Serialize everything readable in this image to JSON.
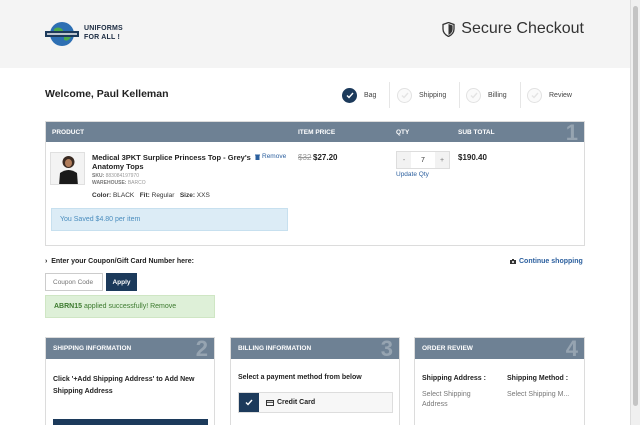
{
  "header": {
    "logo_line1": "UNIFORMS",
    "logo_line2": "FOR ALL !",
    "secure_label": "Secure Checkout"
  },
  "welcome": "Welcome, Paul Kelleman",
  "steps": [
    {
      "label": "Bag",
      "active": true
    },
    {
      "label": "Shipping",
      "active": false
    },
    {
      "label": "Billing",
      "active": false
    },
    {
      "label": "Review",
      "active": false
    }
  ],
  "cart": {
    "columns": [
      "PRODUCT",
      "ITEM PRICE",
      "QTY",
      "SUB TOTAL"
    ],
    "section_number": "1",
    "item": {
      "name": "Medical 3PKT Surplice Princess Top - Grey's Anatomy Tops",
      "sku_label": "SKU:",
      "sku": "883084197970",
      "warehouse_label": "WAREHOUSE:",
      "warehouse": "BARCO",
      "color_label": "Color:",
      "color": "BLACK",
      "fit_label": "Fit:",
      "fit": "Regular",
      "size_label": "Size:",
      "size": "XXS",
      "remove_label": "Remove",
      "original_price": "$32",
      "price": "$27.20",
      "qty_minus": "-",
      "qty": "7",
      "qty_plus": "+",
      "update_label": "Update Qty",
      "subtotal": "$190.40"
    },
    "saved_message": "You Saved $4.80 per item"
  },
  "coupon": {
    "prompt": "Enter your Coupon/Gift Card Number here:",
    "placeholder": "Coupon Code",
    "apply_label": "Apply",
    "applied_code": "ABRN15",
    "applied_text": " applied successfully! ",
    "remove_label": "Remove",
    "continue_label": "Continue shopping"
  },
  "shipping": {
    "title": "SHIPPING INFORMATION",
    "number": "2",
    "text": "Click '+Add Shipping Address' to Add New Shipping Address"
  },
  "billing": {
    "title": "BILLING INFORMATION",
    "number": "3",
    "prompt": "Select a payment method from below",
    "option": "Credit Card"
  },
  "review": {
    "title": "ORDER REVIEW",
    "number": "4",
    "ship_addr_label": "Shipping Address :",
    "ship_addr_value": "Select Shipping Address",
    "ship_method_label": "Shipping Method :",
    "ship_method_value": "Select Shipping M..."
  },
  "colors": {
    "navy": "#1c3a5b",
    "header_gray": "#6e8194",
    "link_blue": "#2b5f9e",
    "success_green": "#3c7a2e"
  }
}
